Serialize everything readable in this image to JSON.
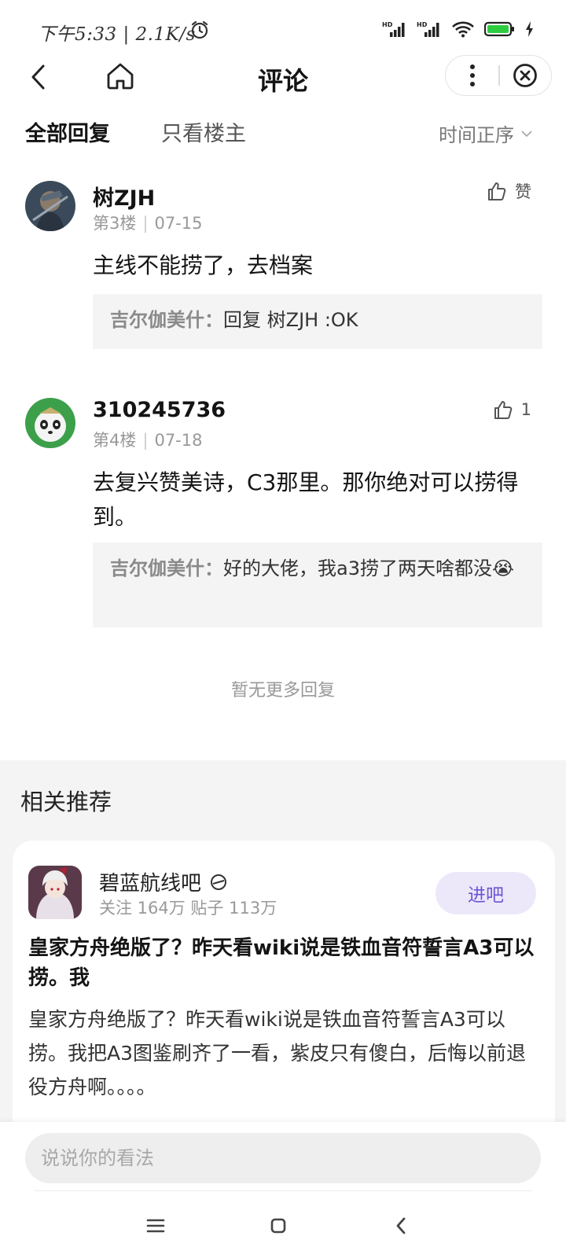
{
  "status_bar": {
    "time": "下午5:33 | 2.1K/s",
    "icons": [
      "alarm-icon",
      "hd-signal-icon",
      "hd-signal-icon",
      "wifi-icon",
      "battery-icon",
      "charging-icon"
    ],
    "battery_color": "#2ecc40"
  },
  "nav": {
    "title": "评论",
    "icons": [
      "back-icon",
      "home-icon",
      "more-icon",
      "close-icon"
    ]
  },
  "tabs": {
    "all": "全部回复",
    "op_only": "只看楼主",
    "sort": "时间正序"
  },
  "comments": [
    {
      "name": "树ZJH",
      "floor": "第3楼",
      "date": "07-15",
      "like_label": "赞",
      "text": "主线不能捞了，去档案",
      "reply_author": "吉尔伽美什：",
      "reply_text": "回复 树ZJH :OK"
    },
    {
      "name": "310245736",
      "floor": "第4楼",
      "date": "07-18",
      "like_label": "1",
      "text": "去复兴赞美诗，C3那里。那你绝对可以捞得到。",
      "reply_author": "吉尔伽美什：",
      "reply_text": "好的大佬，我a3捞了两天啥都没😭"
    }
  ],
  "no_more": "暂无更多回复",
  "related": {
    "title": "相关推荐",
    "forum_name": "碧蓝航线吧",
    "forum_stats": "关注 164万 贴子 113万",
    "enter_label": "进吧",
    "post_title": "皇家方舟绝版了？昨天看wiki说是铁血音符誓言A3可以捞。我",
    "post_body": "皇家方舟绝版了？昨天看wiki说是铁血音符誓言A3可以捞。我把A3图鉴刷齐了一看，紫皮只有傻白，后悔以前退役方舟啊。。。。",
    "accent_color": "#6b55d6"
  },
  "input": {
    "placeholder": "说说你的看法"
  }
}
